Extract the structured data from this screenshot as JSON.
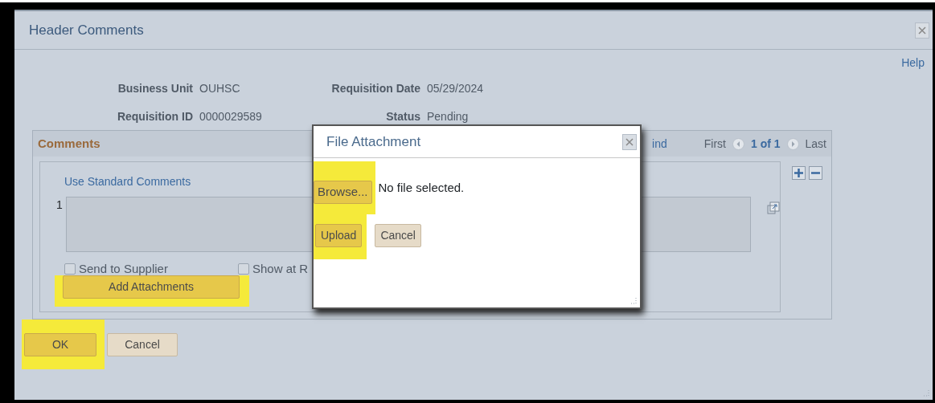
{
  "window": {
    "title": "Header Comments",
    "help_link": "Help"
  },
  "fields": [
    {
      "label": "Business Unit",
      "value": "OUHSC"
    },
    {
      "label": "Requisition Date",
      "value": "05/29/2024"
    },
    {
      "label": "Requisition ID",
      "value": "0000029589"
    },
    {
      "label": "Status",
      "value": "Pending"
    }
  ],
  "comments": {
    "title": "Comments",
    "find_link": "ind",
    "nav": {
      "first": "First",
      "position": "1 of 1",
      "last": "Last"
    },
    "standard_comments_link": "Use Standard Comments",
    "row_number": "1",
    "checkboxes": [
      {
        "label": "Send to Supplier",
        "checked": false
      },
      {
        "label": "Show at R",
        "checked": false
      }
    ],
    "attach_button": {
      "label": "Add Attachments",
      "highlighted": true
    }
  },
  "buttons": [
    {
      "label": "OK",
      "kind": "primary",
      "highlighted": true
    },
    {
      "label": "Cancel",
      "kind": "secondary",
      "highlighted": false
    }
  ],
  "dialog": {
    "title": "File Attachment",
    "browse_button": {
      "label": "Browse...",
      "highlighted": true
    },
    "file_status": "No file selected.",
    "buttons": [
      {
        "label": "Upload",
        "kind": "primary",
        "highlighted": true
      },
      {
        "label": "Cancel",
        "kind": "secondary",
        "highlighted": false
      }
    ]
  }
}
